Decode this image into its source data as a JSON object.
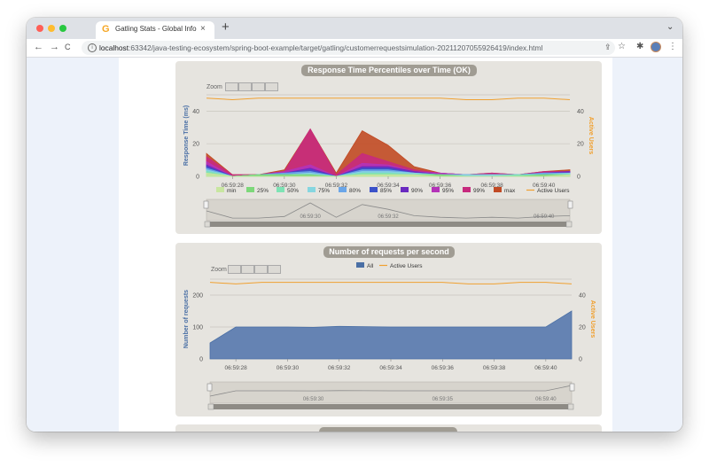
{
  "browser": {
    "tab_title": "Gatling Stats - Global Informatio",
    "favicon_letter": "G",
    "close_glyph": "×",
    "newtab_glyph": "+",
    "menu_chevron": "⌄",
    "back_glyph": "←",
    "forward_glyph": "→",
    "reload_glyph": "C",
    "url_host": "localhost",
    "url_path": ":63342/java-testing-ecosystem/spring-boot-example/target/gatling/customerrequestsimulation-20211207055926419/index.html",
    "share_glyph": "⇪",
    "star_glyph": "☆",
    "extensions_glyph": "✱",
    "kebab_glyph": "⋮",
    "traffic_lights": [
      "#ff5f57",
      "#febc2e",
      "#28c840"
    ]
  },
  "chart_percentiles": {
    "title": "Response Time Percentiles over Time (OK)",
    "zoom_label": "Zoom",
    "ylabel_left": "Response Time (ms)",
    "ylabel_right": "Active Users",
    "left_ticks": [
      "0",
      "20",
      "40"
    ],
    "right_ticks": [
      "0",
      "20",
      "40"
    ],
    "x_ticks": [
      "06:59:28",
      "06:59:30",
      "06:59:32",
      "06:59:34",
      "06:59:36",
      "06:59:38",
      "06:59:40"
    ],
    "nav_labels": [
      "06:59:30",
      "06:59:32",
      "06:59:40"
    ],
    "legend": [
      {
        "label": "min",
        "color": "#c8e6a0"
      },
      {
        "label": "25%",
        "color": "#7dd87a"
      },
      {
        "label": "50%",
        "color": "#7ee3b5"
      },
      {
        "label": "75%",
        "color": "#86d6e0"
      },
      {
        "label": "80%",
        "color": "#6ba6e8"
      },
      {
        "label": "85%",
        "color": "#3b52c9"
      },
      {
        "label": "90%",
        "color": "#6a2ac0"
      },
      {
        "label": "95%",
        "color": "#b433b8"
      },
      {
        "label": "99%",
        "color": "#c72a7e"
      },
      {
        "label": "max",
        "color": "#c14a24"
      },
      {
        "label": "Active Users",
        "color": "#f0a030"
      }
    ]
  },
  "chart_requests": {
    "title": "Number of requests per second",
    "zoom_label": "Zoom",
    "ylabel_left": "Number of requests",
    "ylabel_right": "Active Users",
    "left_ticks": [
      "0",
      "100",
      "200"
    ],
    "right_ticks": [
      "0",
      "20",
      "40"
    ],
    "x_ticks": [
      "06:59:28",
      "06:59:30",
      "06:59:32",
      "06:59:34",
      "06:59:36",
      "06:59:38",
      "06:59:40"
    ],
    "nav_labels": [
      "06:59:30",
      "06:59:35",
      "06:59:40"
    ],
    "legend": [
      {
        "label": "All",
        "color": "#4a6fa5"
      },
      {
        "label": "Active Users",
        "color": "#f0a030"
      }
    ]
  },
  "chart_data": [
    {
      "type": "area",
      "title": "Response Time Percentiles over Time (OK)",
      "xlabel": "",
      "ylabel": "Response Time (ms)",
      "y2label": "Active Users",
      "ylim": [
        0,
        50
      ],
      "y2lim": [
        0,
        50
      ],
      "x": [
        "06:59:27",
        "06:59:28",
        "06:59:29",
        "06:59:30",
        "06:59:31",
        "06:59:32",
        "06:59:33",
        "06:59:34",
        "06:59:35",
        "06:59:36",
        "06:59:37",
        "06:59:38",
        "06:59:39",
        "06:59:40",
        "06:59:41"
      ],
      "series": [
        {
          "name": "min",
          "values": [
            2,
            0,
            0,
            0,
            0,
            0,
            1,
            1,
            1,
            0,
            0,
            0,
            0,
            0,
            1
          ]
        },
        {
          "name": "25%",
          "values": [
            2,
            0,
            1,
            1,
            1,
            0,
            1,
            1,
            1,
            1,
            0,
            0,
            0,
            1,
            1
          ]
        },
        {
          "name": "50%",
          "values": [
            3,
            0,
            1,
            1,
            1,
            0,
            2,
            2,
            1,
            1,
            0,
            0,
            1,
            1,
            1
          ]
        },
        {
          "name": "75%",
          "values": [
            4,
            0,
            1,
            1,
            2,
            0,
            3,
            3,
            2,
            1,
            1,
            1,
            1,
            1,
            2
          ]
        },
        {
          "name": "80%",
          "values": [
            5,
            0,
            1,
            2,
            3,
            0,
            4,
            4,
            2,
            1,
            1,
            1,
            1,
            2,
            2
          ]
        },
        {
          "name": "85%",
          "values": [
            6,
            0,
            1,
            2,
            4,
            0,
            5,
            5,
            2,
            1,
            1,
            1,
            1,
            2,
            2
          ]
        },
        {
          "name": "90%",
          "values": [
            7,
            0,
            1,
            2,
            5,
            0,
            6,
            6,
            3,
            1,
            1,
            1,
            1,
            2,
            3
          ]
        },
        {
          "name": "95%",
          "values": [
            9,
            0,
            1,
            3,
            7,
            0,
            8,
            7,
            3,
            2,
            1,
            1,
            1,
            2,
            3
          ]
        },
        {
          "name": "99%",
          "values": [
            12,
            1,
            1,
            3,
            29,
            1,
            14,
            9,
            4,
            2,
            1,
            2,
            1,
            3,
            3
          ]
        },
        {
          "name": "max",
          "values": [
            14,
            1,
            1,
            4,
            29,
            2,
            28,
            19,
            6,
            2,
            1,
            2,
            1,
            3,
            4
          ]
        },
        {
          "name": "Active Users",
          "axis": "right",
          "values": [
            48,
            47,
            48,
            48,
            48,
            48,
            48,
            48,
            48,
            48,
            47,
            47,
            48,
            48,
            47
          ]
        }
      ]
    },
    {
      "type": "area",
      "title": "Number of requests per second",
      "xlabel": "",
      "ylabel": "Number of requests",
      "y2label": "Active Users",
      "ylim": [
        0,
        250
      ],
      "y2lim": [
        0,
        50
      ],
      "x": [
        "06:59:27",
        "06:59:28",
        "06:59:29",
        "06:59:30",
        "06:59:31",
        "06:59:32",
        "06:59:33",
        "06:59:34",
        "06:59:35",
        "06:59:36",
        "06:59:37",
        "06:59:38",
        "06:59:39",
        "06:59:40",
        "06:59:41"
      ],
      "series": [
        {
          "name": "All",
          "values": [
            50,
            100,
            100,
            100,
            99,
            102,
            101,
            100,
            100,
            100,
            100,
            100,
            100,
            100,
            150
          ]
        },
        {
          "name": "Active Users",
          "axis": "right",
          "values": [
            48,
            47,
            48,
            48,
            48,
            48,
            48,
            48,
            48,
            48,
            47,
            47,
            48,
            48,
            47
          ]
        }
      ]
    }
  ]
}
